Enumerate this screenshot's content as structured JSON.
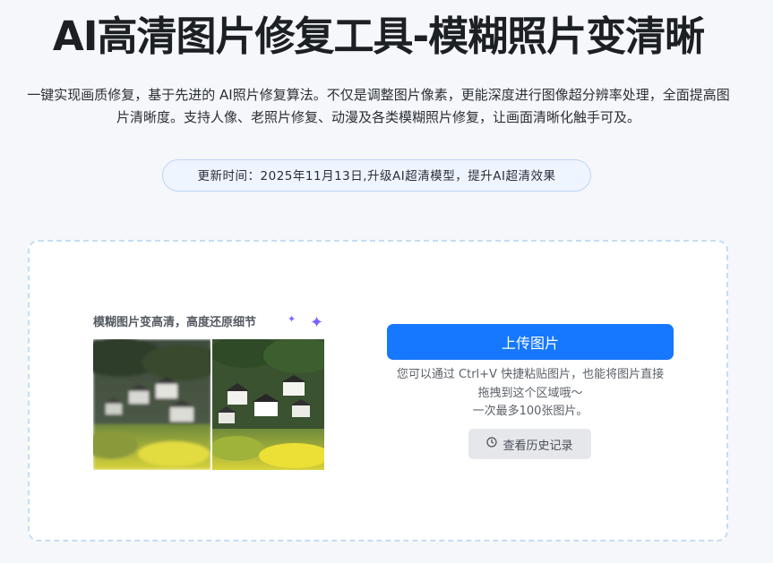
{
  "header": {
    "title": "AI高清图片修复工具-模糊照片变清晰",
    "description": "一键实现画质修复，基于先进的 AI照片修复算法。不仅是调整图片像素，更能深度进行图像超分辨率处理，全面提高图片清晰度。支持人像、老照片修复、动漫及各类模糊照片修复，让画面清晰化触手可及。",
    "update_notice": "更新时间：2025年11月13日,升级AI超清模型，提升AI超清效果"
  },
  "upload": {
    "preview_caption": "模糊图片变高清，高度还原细节",
    "button_label": "上传图片",
    "hint_line1": "您可以通过 Ctrl+V 快捷粘贴图片，也能将图片直接",
    "hint_line2": "拖拽到这个区域哦～",
    "hint_line3": "一次最多100张图片。",
    "history_label": "查看历史记录"
  },
  "icons": {
    "sparkles": "sparkle-icon",
    "history": "clock-icon"
  },
  "colors": {
    "accent": "#1677ff",
    "sparkle": "#7b61ff"
  }
}
